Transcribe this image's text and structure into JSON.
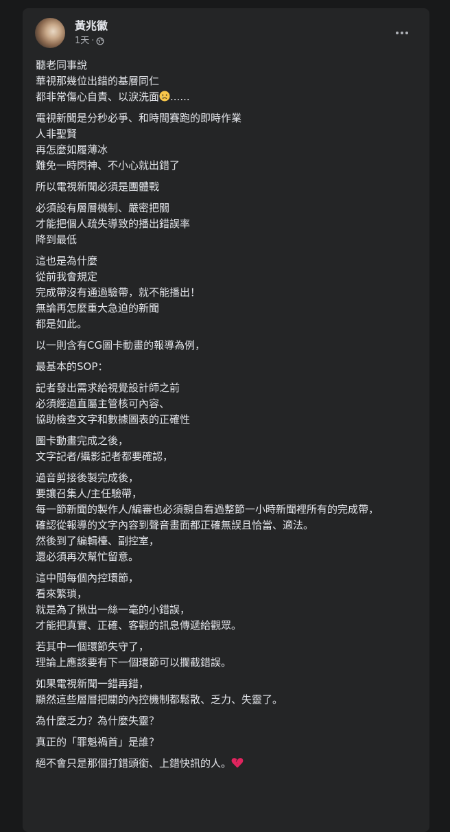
{
  "post": {
    "author": "黃兆徽",
    "time": "1天",
    "separator": "·",
    "privacy_icon": "globe-icon",
    "more_icon": "more-options-icon",
    "paragraphs": [
      [
        "聽老同事說",
        "華視那幾位出錯的基層同仁",
        "都非常傷心自責、以淚洗面"
      ],
      [
        "電視新聞是分秒必爭、和時間賽跑的即時作業",
        "人非聖賢",
        "再怎麼如履薄冰",
        "難免一時閃神、不小心就出錯了"
      ],
      [
        "所以電視新聞必須是團體戰"
      ],
      [
        "必須設有層層機制、嚴密把關",
        "才能把個人疏失導致的播出錯誤率",
        "降到最低"
      ],
      [
        "這也是為什麼",
        "從前我會規定",
        "完成帶沒有通過驗帶，就不能播出！",
        "無論再怎麼重大急迫的新聞",
        "都是如此。"
      ],
      [
        "以一則含有CG圖卡動畫的報導為例，"
      ],
      [
        "最基本的SOP："
      ],
      [
        "記者發出需求給視覺設計師之前",
        "必須經過直屬主管核可內容、",
        "協助檢查文字和數據圖表的正確性"
      ],
      [
        "圖卡動畫完成之後，",
        "文字記者/攝影記者都要確認，"
      ],
      [
        "過音剪接後製完成後，",
        "要讓召集人/主任驗帶，",
        "每一節新聞的製作人/編審也必須親自看過整節一小時新聞裡所有的完成帶，",
        "確認從報導的文字內容到聲音畫面都正確無誤且恰當、適法。",
        "然後到了編輯檯、副控室，",
        "還必須再次幫忙留意。"
      ],
      [
        "這中間每個內控環節，",
        "看來繁瑣，",
        "就是為了揪出一絲一毫的小錯誤，",
        "才能把真實、正確、客觀的訊息傳遞給觀眾。"
      ],
      [
        "若其中一個環節失守了，",
        "理論上應該要有下一個環節可以攔截錯誤。"
      ],
      [
        "如果電視新聞一錯再錯，",
        "顯然這些層層把關的內控機制都鬆散、乏力、失靈了。"
      ],
      [
        "為什麼乏力？為什麼失靈？"
      ],
      [
        "真正的「罪魁禍首」是誰？"
      ],
      [
        "絕不會只是那個打錯頭銜、上錯快訊的人。"
      ]
    ],
    "line_suffixes": {
      "p0_l2": "......",
      "p15_l0": ""
    }
  },
  "colors": {
    "page_bg": "#18191a",
    "card_bg": "#242526",
    "text_primary": "#e4e6eb",
    "text_secondary": "#b0b3b8",
    "sad_emoji": "#f7c64a",
    "broken_heart": "#e0245e"
  }
}
